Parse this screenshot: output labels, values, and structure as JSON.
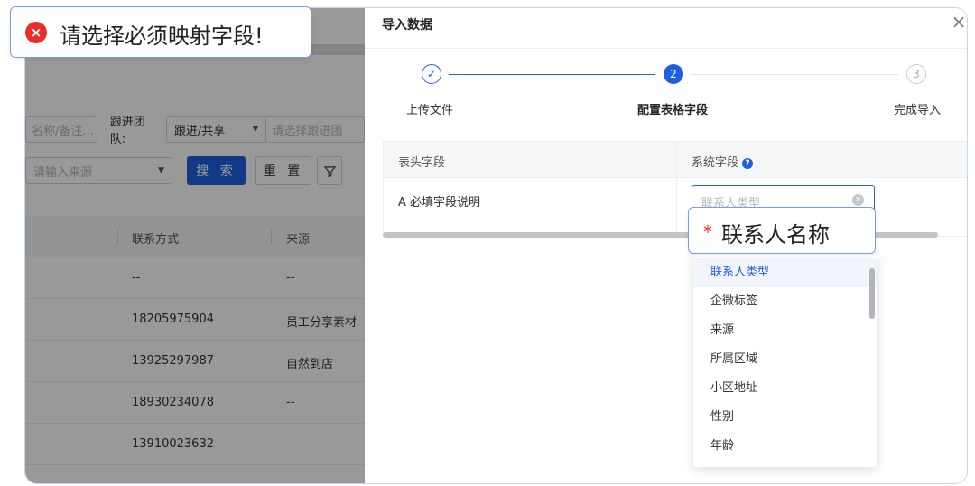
{
  "background_page": {
    "filters_row1": {
      "name_placeholder": "名称/备注...",
      "team_label": "跟进团队:",
      "team_select": "跟进/共享",
      "follower_placeholder": "请选择跟进团"
    },
    "filters_row2": {
      "source_placeholder": "请输入来源",
      "search_button": "搜 索",
      "reset_button": "重 置"
    },
    "table": {
      "headers": [
        "联系方式",
        "来源"
      ],
      "rows": [
        [
          "--",
          "--"
        ],
        [
          "18205975904",
          "员工分享素材"
        ],
        [
          "13925297987",
          "自然到店"
        ],
        [
          "18930234078",
          "--"
        ],
        [
          "13910023632",
          "--"
        ],
        [
          "--",
          "--"
        ]
      ]
    }
  },
  "drawer": {
    "title": "导入数据",
    "close_label": "×",
    "steps": [
      {
        "label": "上传文件",
        "status": "done",
        "marker": "✓"
      },
      {
        "label": "配置表格字段",
        "status": "active",
        "marker": "2"
      },
      {
        "label": "完成导入",
        "status": "pending",
        "marker": "3"
      }
    ],
    "mapping": {
      "header_col": "表头字段",
      "system_col": "系统字段",
      "help_icon": "?",
      "row_field": "A 必填字段说明",
      "select_placeholder": "联系人类型"
    },
    "dropdown_options": [
      "联系人类型",
      "企微标签",
      "来源",
      "所属区域",
      "小区地址",
      "性别",
      "年龄"
    ],
    "dropdown_selected": "联系人类型"
  },
  "callouts": {
    "error_toast": "请选择必须映射字段!",
    "error_icon": "×",
    "required_tip_star": "*",
    "required_tip": "联系人名称"
  },
  "colors": {
    "primary": "#1f5fe0",
    "error": "#e8302a",
    "callout_border": "#7a9be8"
  }
}
